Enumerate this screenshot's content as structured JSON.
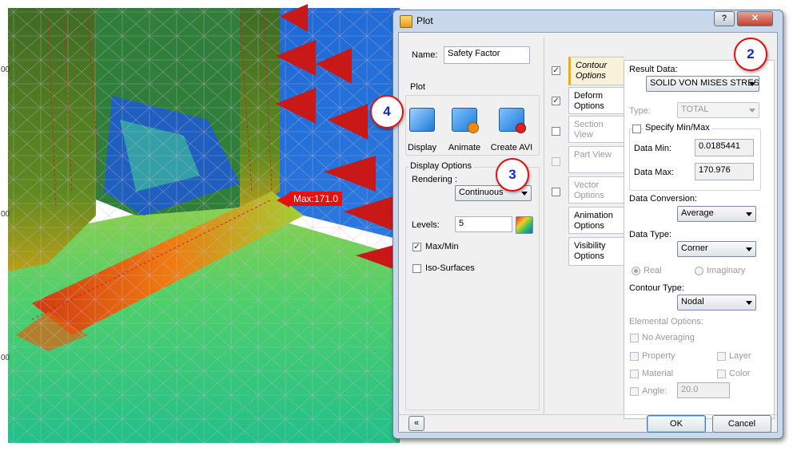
{
  "viewport": {
    "max_label": "Max:171.0"
  },
  "dialog": {
    "title": "Plot",
    "help_button": "?",
    "close_button": "✕",
    "name_label": "Name:",
    "name_value": "Safety Factor",
    "plot_group_label": "Plot",
    "plot_buttons": [
      "Display",
      "Animate",
      "Create AVI"
    ],
    "display_options_label": "Display Options",
    "rendering_label": "Rendering :",
    "rendering_value": "Continuous",
    "levels_label": "Levels:",
    "levels_value": "5",
    "max_min_label": "Max/Min",
    "max_min_checked": true,
    "iso_surfaces_label": "Iso-Surfaces",
    "iso_surfaces_checked": false,
    "tabs": [
      {
        "label": "Contour Options",
        "checked": true,
        "enabled": true,
        "selected": true
      },
      {
        "label": "Deform Options",
        "checked": true,
        "enabled": true,
        "selected": false
      },
      {
        "label": "Section View",
        "checked": false,
        "enabled": false,
        "selected": false
      },
      {
        "label": "Part View",
        "checked": false,
        "enabled": false,
        "selected": false
      },
      {
        "label": "Vector Options",
        "checked": false,
        "enabled": false,
        "selected": false
      },
      {
        "label": "Animation Options",
        "checked": false,
        "enabled": true,
        "selected": false
      },
      {
        "label": "Visibility Options",
        "checked": false,
        "enabled": true,
        "selected": false
      }
    ],
    "contour": {
      "result_data_label": "Result Data:",
      "result_data_value": "SOLID VON MISES STRESS",
      "type_label": "Type:",
      "type_value": "TOTAL",
      "specify_label": "Specify Min/Max",
      "data_min_label": "Data Min:",
      "data_min_value": "0.0185441",
      "data_max_label": "Data Max:",
      "data_max_value": "170.976",
      "data_conversion_label": "Data Conversion:",
      "data_conversion_value": "Average",
      "data_type_label": "Data Type:",
      "data_type_value": "Corner",
      "real_label": "Real",
      "imaginary_label": "Imaginary",
      "contour_type_label": "Contour Type:",
      "contour_type_value": "Nodal",
      "elemental_label": "Elemental Options:",
      "no_averaging_label": "No Averaging",
      "property_label": "Property",
      "layer_label": "Layer",
      "material_label": "Material",
      "color_label": "Color",
      "angle_label": "Angle:",
      "angle_value": "20.0"
    },
    "expand_button": "«",
    "ok_label": "OK",
    "cancel_label": "Cancel"
  },
  "badges": [
    "2",
    "3",
    "4"
  ],
  "colors": {
    "max_label_bg": "#e51010",
    "badge_border": "#e01010",
    "badge_text": "#1428c8",
    "selected_tab_accent": "#f0b000"
  }
}
